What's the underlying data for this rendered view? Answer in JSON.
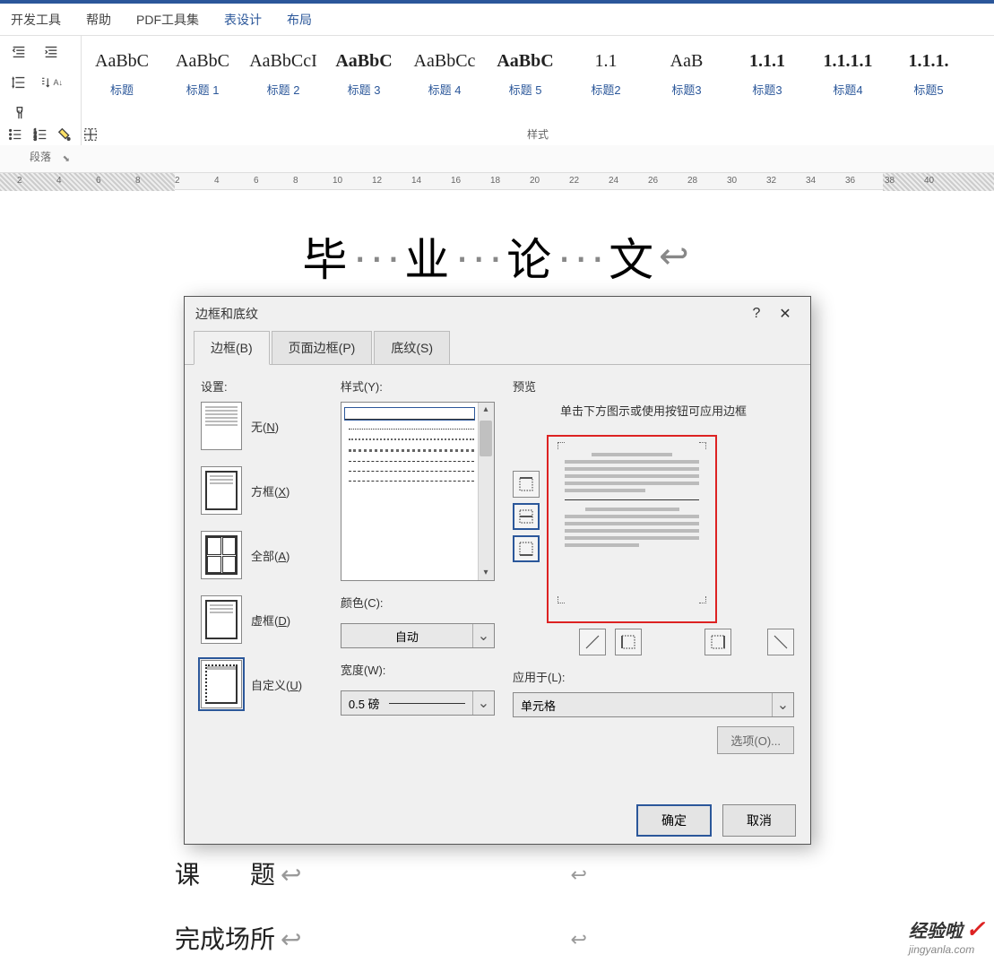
{
  "menu": {
    "items": [
      "开发工具",
      "帮助",
      "PDF工具集",
      "表设计",
      "布局"
    ]
  },
  "ribbon": {
    "paragraph_label": "段落",
    "styles_label": "样式",
    "styles": [
      {
        "prev": "AaBbC",
        "lbl": "标题",
        "bold": false
      },
      {
        "prev": "AaBbC",
        "lbl": "标题 1",
        "bold": false
      },
      {
        "prev": "AaBbCcI",
        "lbl": "标题 2",
        "bold": false
      },
      {
        "prev": "AaBbC",
        "lbl": "标题 3",
        "bold": true
      },
      {
        "prev": "AaBbCc",
        "lbl": "标题 4",
        "bold": false
      },
      {
        "prev": "AaBbC",
        "lbl": "标题 5",
        "bold": true
      },
      {
        "prev": "1.1",
        "lbl": "标题2",
        "bold": false
      },
      {
        "prev": "AaB",
        "lbl": "标题3",
        "bold": false
      },
      {
        "prev": "1.1.1",
        "lbl": "标题3",
        "bold": true
      },
      {
        "prev": "1.1.1.1",
        "lbl": "标题4",
        "bold": true
      },
      {
        "prev": "1.1.1.",
        "lbl": "标题5",
        "bold": true
      }
    ]
  },
  "doc": {
    "title_chars": [
      "毕",
      "业",
      "论",
      "文"
    ],
    "labels": [
      "课　　题",
      "完成场所"
    ]
  },
  "dialog": {
    "title": "边框和底纹",
    "tabs": [
      "边框(B)",
      "页面边框(P)",
      "底纹(S)"
    ],
    "settings": {
      "label": "设置:",
      "items": [
        {
          "txt": "无(N)",
          "type": "none"
        },
        {
          "txt": "方框(X)",
          "type": "box"
        },
        {
          "txt": "全部(A)",
          "type": "all"
        },
        {
          "txt": "虚框(D)",
          "type": "dash"
        },
        {
          "txt": "自定义(U)",
          "type": "custom"
        }
      ]
    },
    "style": {
      "label": "样式(Y):"
    },
    "color": {
      "label": "颜色(C):",
      "value": "自动"
    },
    "width": {
      "label": "宽度(W):",
      "value": "0.5 磅"
    },
    "preview": {
      "label": "预览",
      "hint": "单击下方图示或使用按钮可应用边框"
    },
    "apply": {
      "label": "应用于(L):",
      "value": "单元格"
    },
    "options_btn": "选项(O)...",
    "ok": "确定",
    "cancel": "取消"
  },
  "watermark": {
    "brand": "经验啦",
    "url": "jingyanla.com",
    "check": "✓"
  }
}
